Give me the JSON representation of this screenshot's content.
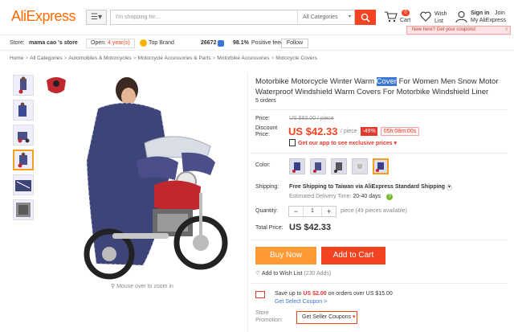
{
  "header": {
    "logo": "AliExpress",
    "search_placeholder": "I'm shopping for...",
    "search_category": "All Categories",
    "cart_count": "0",
    "cart_label": "Cart",
    "wish_label_1": "Wish",
    "wish_label_2": "List",
    "signin": "Sign in",
    "join": "Join",
    "my_aliexpress": "My AliExpress"
  },
  "storebar": {
    "store_label": "Store:",
    "store_name": "mama cao 's store",
    "open_prefix": "Open:",
    "open_years": "4 year(s)",
    "top_brand": "Top Brand",
    "score": "26672",
    "feedback": "98.1%",
    "feedback_label": "Positive feedback",
    "follow": "Follow",
    "coupon_tip": "New here? Get your coupons!",
    "coupon_close": "x"
  },
  "breadcrumb": [
    "Home",
    "All Categories",
    "Automobiles & Motorcycles",
    "Motorcycle Accessories & Parts",
    "Motorbike Accessories",
    "Motocycle Covers"
  ],
  "gallery": {
    "zoom_hint": "Mouse over to zoom in"
  },
  "product": {
    "title_before": "Motorbike Motorcycle Winter Warm ",
    "title_highlight": "Cover",
    "title_after": " For Women Men Snow Motor Waterproof Windshield Warm Covers For Motorbike Windshield Liner",
    "orders": "5 orders",
    "price_label": "Price:",
    "old_price": "US $83.00 / piece",
    "discount_label_1": "Discount",
    "discount_label_2": "Price:",
    "current_price": "US $42.33",
    "per_piece": "/ piece",
    "off": "-49%",
    "timer": "05h:08m:00s",
    "app_promo": "Get our app to see exclusive prices",
    "color_label": "Color:",
    "shipping_label": "Shipping:",
    "ship_free": "Free Shipping to Taiwan via AliExpress Standard Shipping",
    "ship_time_label": "Estimated Delivery Time:",
    "ship_time": "20-40 days",
    "quantity_label": "Quantity:",
    "quantity": "1",
    "qty_available": "piece (49 pieces available)",
    "total_label": "Total Price:",
    "total": "US $42.33",
    "buy_now": "Buy Now",
    "add_to_cart": "Add to Cart",
    "wishlist": "Add to Wish List",
    "wishlist_count": "(230 Adds)",
    "promo_prefix": "Save up to",
    "promo_amount": "US $2.00",
    "promo_suffix": "on orders over US $15.00",
    "promo_link": "Get Select Coupon >",
    "store_promo_1": "Store",
    "store_promo_2": "Promotion:",
    "seller_coupons": "Get Seller Coupons"
  },
  "colors": {
    "accent": "#ff6a00",
    "price_red": "#f44321",
    "buy_orange": "#ff9933",
    "link_blue": "#3b77d8"
  }
}
